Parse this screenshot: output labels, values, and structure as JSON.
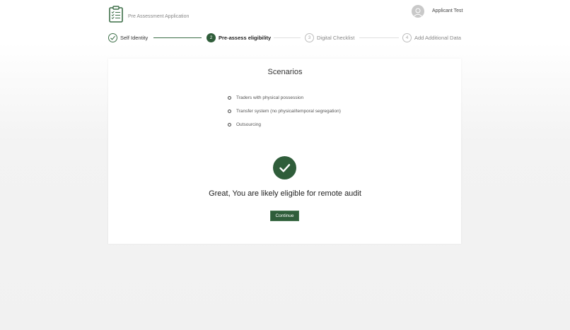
{
  "header": {
    "app_title": "Pre Assessment Application",
    "user_name": "Applicant Test"
  },
  "stepper": {
    "steps": [
      {
        "number": "1",
        "label": "Self Identity",
        "state": "completed"
      },
      {
        "number": "2",
        "label": "Pre-assess eligibility",
        "state": "active"
      },
      {
        "number": "3",
        "label": "Digital Checklist",
        "state": "pending"
      },
      {
        "number": "4",
        "label": "Add Additional Data",
        "state": "pending"
      }
    ]
  },
  "main": {
    "title": "Scenarios",
    "scenarios": [
      "Traders with physical possession",
      "Transfer system (no physical/temporal segregation)",
      "Outsourcing"
    ],
    "result_message": "Great, You are likely eligible for remote audit",
    "continue_label": "Continue"
  },
  "colors": {
    "primary": "#2f5d3a",
    "muted": "#bdbdbd"
  },
  "icons": {
    "logo": "clipboard-icon",
    "avatar": "user-icon",
    "completed_step": "check-icon",
    "result": "check-circle-icon"
  }
}
